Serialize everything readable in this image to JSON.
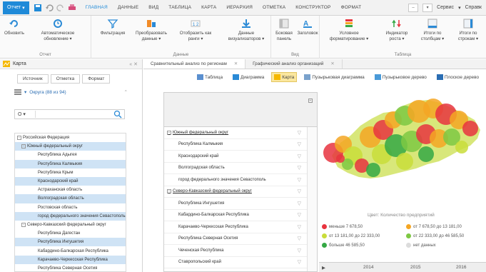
{
  "ribbon_tabs": {
    "file": "Отчет",
    "items": [
      "ГЛАВНАЯ",
      "ДАННЫЕ",
      "ВИД",
      "ТАБЛИЦА",
      "КАРТА",
      "ИЕРАРХИЯ",
      "ОТМЕТКА",
      "КОНСТРУКТОР",
      "ФОРМАТ"
    ],
    "active": "ГЛАВНАЯ",
    "service": "Сервис",
    "help": "Справк"
  },
  "ribbon": {
    "refresh": "Обновить",
    "auto_refresh": "Автоматическое обновление",
    "group_report": "Отчет",
    "filter": "Фильтрация",
    "transform": "Преобразовать данные",
    "show_as_ranks": "Отобразить как ранги",
    "data_visualizers": "Данные визуализаторов",
    "group_data": "Данные",
    "side_panel": "Боковая панель",
    "header": "Заголовок",
    "group_view": "Вид",
    "cond_format": "Условное форматирование",
    "growth_indicator": "Индикатор роста",
    "totals_columns": "Итоги по столбцам",
    "totals_rows": "Итоги по строкам",
    "group_table": "Таблица"
  },
  "left_panel": {
    "title": "Карта",
    "tabs": [
      "Источник",
      "Отметка",
      "Формат"
    ],
    "dimension": "Округа (88 из 94)",
    "search_prefix": "O",
    "tree": [
      {
        "label": "Российская Федерация",
        "level": 0,
        "expand": "-",
        "selected": false
      },
      {
        "label": "Южный федеральный округ",
        "level": 1,
        "expand": "-",
        "selected": true
      },
      {
        "label": "Республика Адыгея",
        "level": 2,
        "selected": false
      },
      {
        "label": "Республика Калмыкия",
        "level": 2,
        "selected": true
      },
      {
        "label": "Республика Крым",
        "level": 2,
        "selected": false
      },
      {
        "label": "Краснодарский край",
        "level": 2,
        "selected": true
      },
      {
        "label": "Астраханская область",
        "level": 2,
        "selected": false
      },
      {
        "label": "Волгоградская область",
        "level": 2,
        "selected": true
      },
      {
        "label": "Ростовская область",
        "level": 2,
        "selected": false
      },
      {
        "label": "город федерального значения Севастополь",
        "level": 2,
        "selected": true
      },
      {
        "label": "Северо-Кавказский федеральный округ",
        "level": 1,
        "expand": "-",
        "selected": false
      },
      {
        "label": "Республика Дагестан",
        "level": 2,
        "selected": false
      },
      {
        "label": "Республика Ингушетия",
        "level": 2,
        "selected": true
      },
      {
        "label": "Кабардино-Балкарская Республика",
        "level": 2,
        "selected": false
      },
      {
        "label": "Карачаево-Черкесская Республика",
        "level": 2,
        "selected": true
      },
      {
        "label": "Республика Северная Осетия",
        "level": 2,
        "selected": false
      }
    ]
  },
  "doc_tabs": [
    {
      "label": "Сравнительный анализ по регионам",
      "active": true
    },
    {
      "label": "Графический анализ организаций",
      "active": false
    }
  ],
  "views": [
    {
      "label": "Таблица",
      "active": false
    },
    {
      "label": "Диаграмма",
      "active": false
    },
    {
      "label": "Карта",
      "active": true
    },
    {
      "label": "Пузырьковая диаграмма",
      "active": false
    },
    {
      "label": "Пузырьковое дерево",
      "active": false
    },
    {
      "label": "Плоское дерево",
      "active": false
    }
  ],
  "table_rows": [
    {
      "label": "Южный федеральный округ",
      "group": true
    },
    {
      "label": "Республика Калмыкия",
      "group": false
    },
    {
      "label": "Краснодарский край",
      "group": false
    },
    {
      "label": "Волгоградская область",
      "group": false
    },
    {
      "label": "город федерального значения Севастополь",
      "group": false
    },
    {
      "label": "Северо-Кавказский федеральный округ",
      "group": true
    },
    {
      "label": "Республика Ингушетия",
      "group": false
    },
    {
      "label": "Кабардино-Балкарская Республика",
      "group": false
    },
    {
      "label": "Карачаево-Черкесская Республика",
      "group": false
    },
    {
      "label": "Республика Северная Осетия",
      "group": false
    },
    {
      "label": "Чеченская Республика",
      "group": false
    },
    {
      "label": "Ставропольский край",
      "group": false
    }
  ],
  "map": {
    "legend_title": "Цвет: Количество предприятий",
    "legend": [
      {
        "label": "меньше 7 678,50",
        "color": "#e8343f"
      },
      {
        "label": "от 7 678,50 до 13 181,00",
        "color": "#f5a623"
      },
      {
        "label": "от 13 181,00 до 22 333,00",
        "color": "#c9dd3a"
      },
      {
        "label": "от 22 333,00 до 46 585,50",
        "color": "#7ec843"
      },
      {
        "label": "больше 46 585,50",
        "color": "#35a845"
      },
      {
        "label": "нет данных",
        "color": "#dcdcdc"
      }
    ],
    "timeline": [
      "2014",
      "2015",
      "2016"
    ]
  }
}
